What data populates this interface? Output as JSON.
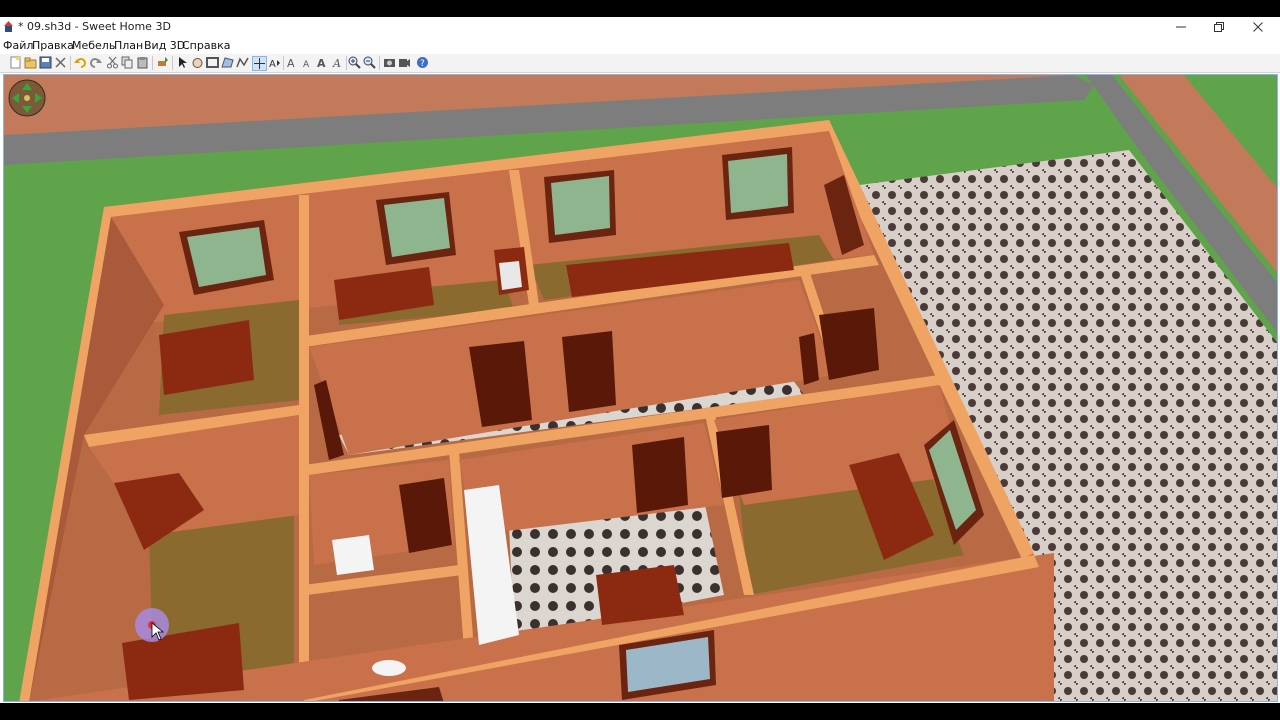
{
  "window": {
    "title": "* 09.sh3d - Sweet Home 3D",
    "minimize_icon": "minimize-icon",
    "restore_icon": "restore-icon",
    "close_icon": "close-icon"
  },
  "menu": [
    {
      "label": "Файл"
    },
    {
      "label": "Правка"
    },
    {
      "label": "Мебель"
    },
    {
      "label": "План"
    },
    {
      "label": "Вид 3D"
    },
    {
      "label": "Справка"
    }
  ],
  "toolbar": {
    "icons": [
      "new-home-icon",
      "open-icon",
      "save-icon",
      "cut-home-icon",
      "undo-icon",
      "redo-icon",
      "cut-icon",
      "copy-icon",
      "paste-icon",
      "add-furniture-icon",
      "select-mode-icon",
      "pan-mode-icon",
      "create-walls-icon",
      "create-rooms-icon",
      "create-polylines-icon",
      "create-dimensions-icon",
      "create-labels-icon",
      "increase-text-icon",
      "decrease-text-icon",
      "text-style-icon",
      "zoom-in-icon",
      "zoom-out-icon",
      "create-photo-icon",
      "create-video-icon",
      "help-icon"
    ]
  },
  "view3d": {
    "navigation_icon": "navigation-arrows-icon",
    "cursor_icon": "mouse-cursor-icon",
    "colors": {
      "grass": "#5fa34a",
      "road": "#7d7d7d",
      "wall": "#c8714a",
      "wall_top": "#f0a464",
      "floor": "#8a6a2e",
      "furniture": "#8b2a10"
    }
  }
}
